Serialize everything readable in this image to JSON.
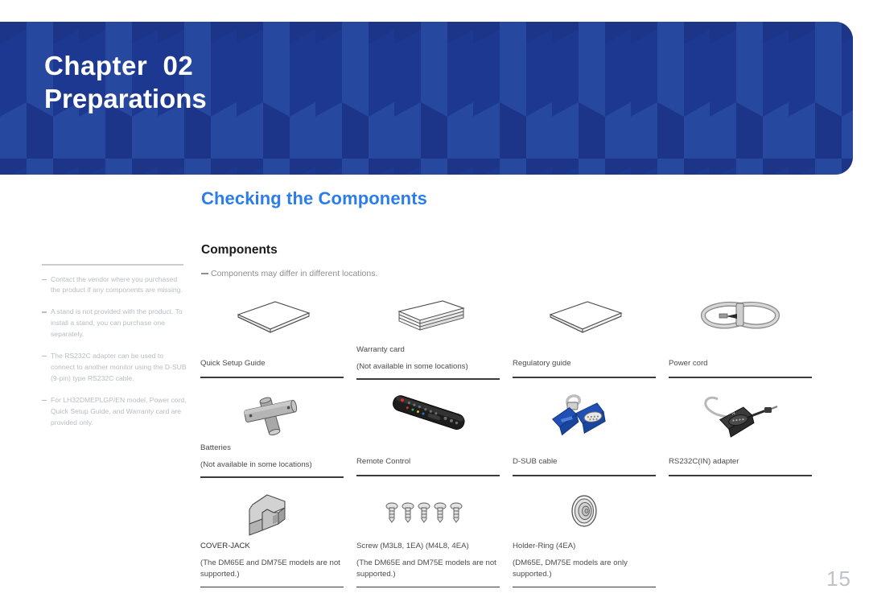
{
  "header": {
    "chapter_label": "Chapter  02",
    "chapter_title": "Preparations",
    "banner_color": "#21409a"
  },
  "section": {
    "title": "Checking the Components",
    "title_color": "#2b7de9",
    "sub_heading": "Components",
    "top_note": "Components may differ in different locations."
  },
  "sidebar": {
    "notes": [
      "Contact the vendor where you purchased the product if any components are missing.",
      "A stand is not provided with the product. To install a stand, you can purchase one separately.",
      "The RS232C adapter can be used to connect to another monitor using the D-SUB (9-pin) type RS232C cable.",
      "For LH32DMEPLGP/EN model, Power cord, Quick Setup Guide, and Warranty card are provided only."
    ]
  },
  "components": {
    "rows": [
      [
        {
          "icon": "book-flat-icon",
          "label": "Quick Setup Guide",
          "sub": ""
        },
        {
          "icon": "booklet-stack-icon",
          "label": "Warranty card",
          "sub": "(Not available in some locations)"
        },
        {
          "icon": "book-flat-icon",
          "label": "Regulatory guide",
          "sub": ""
        },
        {
          "icon": "power-cord-icon",
          "label": "Power cord",
          "sub": ""
        }
      ],
      [
        {
          "icon": "batteries-icon",
          "label": "Batteries",
          "sub": "(Not available in some locations)"
        },
        {
          "icon": "remote-control-icon",
          "label": "Remote Control",
          "sub": ""
        },
        {
          "icon": "dsub-cable-icon",
          "label": "D-SUB cable",
          "sub": ""
        },
        {
          "icon": "rs232c-adapter-icon",
          "label": "RS232C(IN) adapter",
          "sub": ""
        }
      ],
      [
        {
          "icon": "cover-jack-icon",
          "label": "COVER-JACK",
          "sub": "(The DM65E and DM75E models are not supported.)"
        },
        {
          "icon": "screws-icon",
          "label": "Screw (M3L8, 1EA) (M4L8, 4EA)",
          "sub": "(The DM65E and DM75E models are not supported.)"
        },
        {
          "icon": "holder-ring-icon",
          "label": "Holder-Ring (4EA)",
          "sub": "(DM65E, DM75E models are only supported.)"
        }
      ]
    ]
  },
  "footer": {
    "page_number": "15"
  }
}
